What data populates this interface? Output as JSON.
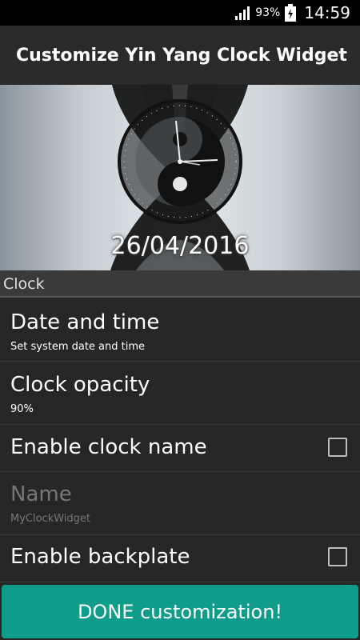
{
  "status_bar": {
    "battery_percent": "93%",
    "time": "14:59"
  },
  "action_bar": {
    "title": "Customize Yin Yang Clock Widget"
  },
  "preview": {
    "date": "26/04/2016"
  },
  "section": {
    "label": "Clock"
  },
  "prefs": {
    "date_time": {
      "title": "Date and time",
      "summary": "Set system date and time"
    },
    "opacity": {
      "title": "Clock opacity",
      "summary": "90%"
    },
    "enable_name": {
      "title": "Enable clock name",
      "checked": false
    },
    "name": {
      "title": "Name",
      "summary": "MyClockWidget",
      "enabled": false
    },
    "enable_backplate": {
      "title": "Enable backplate",
      "checked": false
    }
  },
  "done_button": {
    "label": "DONE customization!"
  },
  "colors": {
    "accent": "#0f9c8a",
    "background": "#262626",
    "status_bar": "#000000"
  },
  "icons": [
    "signal-icon",
    "battery-icon"
  ]
}
